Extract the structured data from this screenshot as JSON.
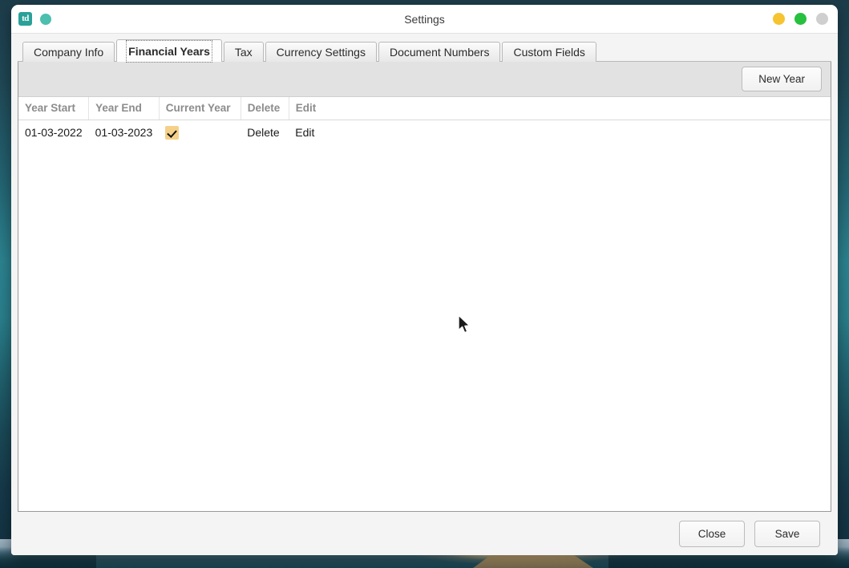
{
  "window": {
    "title": "Settings",
    "app_icon_label": "td",
    "controls": {
      "minimize_label": "",
      "maximize_label": "",
      "close_label": ""
    }
  },
  "tabs": [
    {
      "label": "Company Info",
      "active": false
    },
    {
      "label": "Financial Years",
      "active": true
    },
    {
      "label": "Tax",
      "active": false
    },
    {
      "label": "Currency Settings",
      "active": false
    },
    {
      "label": "Document Numbers",
      "active": false
    },
    {
      "label": "Custom Fields",
      "active": false
    }
  ],
  "toolbar": {
    "new_year_label": "New Year"
  },
  "table": {
    "columns": [
      "Year Start",
      "Year End",
      "Current Year",
      "Delete",
      "Edit"
    ],
    "rows": [
      {
        "year_start": "01-03-2022",
        "year_end": "01-03-2023",
        "current_year": true,
        "delete_label": "Delete",
        "edit_label": "Edit"
      }
    ]
  },
  "footer": {
    "close_label": "Close",
    "save_label": "Save"
  },
  "colors": {
    "accent_teal": "#2aa198",
    "status_dot": "#4cbfaf",
    "check_badge_bg": "#f5d089",
    "minimize": "#f6c431",
    "maximize": "#28c03f",
    "close": "#cfcfcf",
    "header_text": "#8c8c8c"
  }
}
